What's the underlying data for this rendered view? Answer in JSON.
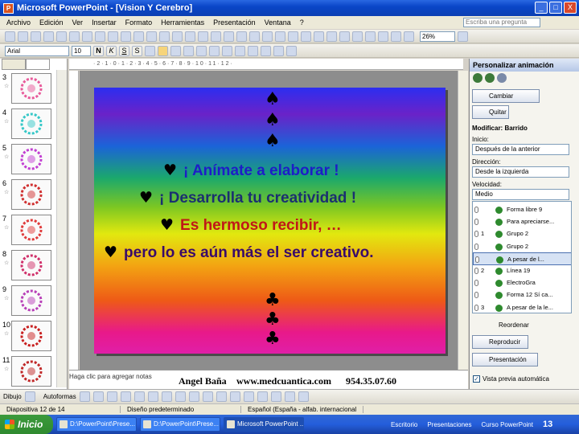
{
  "window": {
    "title": "Microsoft PowerPoint - [Vision Y Cerebro]",
    "buttons": [
      "_",
      "□",
      "X"
    ]
  },
  "menu": {
    "items": [
      "Archivo",
      "Edición",
      "Ver",
      "Insertar",
      "Formato",
      "Herramientas",
      "Presentación",
      "Ventana",
      "?"
    ],
    "ask_placeholder": "Escriba una pregunta"
  },
  "toolbar": {
    "zoom": "26%",
    "font": "Arial",
    "font_size": "10",
    "bold": "N",
    "italic": "K",
    "underline": "S",
    "shadow": "S"
  },
  "slides_pane": {
    "slides": [
      {
        "num": "3",
        "color": "#e85a9a"
      },
      {
        "num": "4",
        "color": "#36c8c8"
      },
      {
        "num": "5",
        "color": "#c23fd2"
      },
      {
        "num": "6",
        "color": "#d03030"
      },
      {
        "num": "7",
        "color": "#e03c3c"
      },
      {
        "num": "8",
        "color": "#d0306a"
      },
      {
        "num": "9",
        "color": "#b840b8"
      },
      {
        "num": "10",
        "color": "#c82020"
      },
      {
        "num": "11",
        "color": "#c02828"
      }
    ]
  },
  "slide": {
    "top_suits": [
      "♠",
      "♠",
      "♠"
    ],
    "bottom_suits": [
      "♣",
      "♣",
      "♣"
    ],
    "lines": [
      {
        "bullet": "♥",
        "text": "¡ Anímate a elaborar !",
        "color": "#1d1dc8"
      },
      {
        "bullet": "♥",
        "text": "¡ Desarrolla tu creatividad !",
        "color": "#1a3070"
      },
      {
        "bullet": "♥",
        "text": "Es hermoso recibir, …",
        "color": "#c01818"
      },
      {
        "bullet": "♥",
        "text": "pero lo es aún más el ser creativo.",
        "color": "#3a0a6a"
      }
    ]
  },
  "notes": {
    "placeholder": "Haga clic para agregar notas",
    "credit": "Angel Baña",
    "web": "www.medcuantica.com",
    "phone": "954.35.07.60"
  },
  "task_pane": {
    "title": "Personalizar animación",
    "change_button": "Cambiar",
    "remove_button": "Quitar",
    "modify_label": "Modificar: Barrido",
    "start_label": "Inicio:",
    "start_value": "Después de la anterior",
    "direction_label": "Dirección:",
    "direction_value": "Desde la izquierda",
    "speed_label": "Velocidad:",
    "speed_value": "Medio",
    "list": [
      {
        "num": "",
        "text": "Forma libre 9",
        "selected": false
      },
      {
        "num": "",
        "text": "Para apreciarse...",
        "selected": false
      },
      {
        "num": "1",
        "text": "Grupo 2",
        "selected": false
      },
      {
        "num": "",
        "text": "Grupo 2",
        "selected": false
      },
      {
        "num": "",
        "text": "A pesar de l...",
        "selected": true
      },
      {
        "num": "2",
        "text": "Línea 19",
        "selected": false
      },
      {
        "num": "",
        "text": "ElectroGra",
        "selected": false
      },
      {
        "num": "",
        "text": "Forma 12 Sí ca...",
        "selected": false
      },
      {
        "num": "3",
        "text": "A pesar de la le...",
        "selected": false
      }
    ],
    "reorder_label": "Reordenar",
    "play_button": "Reproducir",
    "slideshow_button": "Presentación",
    "autopreview_label": "Vista previa automática",
    "autopreview_checked": "✓"
  },
  "drawing_toolbar": {
    "draw_label": "Dibujo",
    "autoshapes_label": "Autoformas"
  },
  "status": {
    "slide_info": "Diapositiva 12 de 14",
    "design": "Diseño predeterminado",
    "language": "Español (España - alfab. internacional"
  },
  "taskbar": {
    "start": "Inicio",
    "items": [
      "D:\\PowerPoint\\Prese...",
      "D:\\PowerPoint\\Prese...",
      "Microsoft PowerPoint ..."
    ],
    "tray": [
      "Escritorio",
      "Presentaciones",
      "Curso PowerPoint"
    ],
    "clock": "13"
  }
}
